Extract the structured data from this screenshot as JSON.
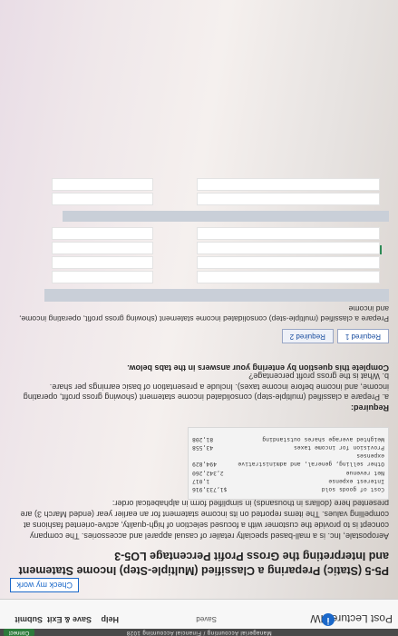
{
  "header": {
    "brand_strip_text": "Managerial Accounting / Financial Accounting 1028",
    "connect_label": "Connect",
    "course_title": "Post Lecture HW",
    "info_icon": "i",
    "saved_label": "Saved",
    "help_label": "Help",
    "save_exit_label": "Save & Exit",
    "submit_label": "Submit",
    "check_work_label": "Check my work"
  },
  "question": {
    "title": "P5-5 (Static) Preparing a Classified (Multiple-Step) Income Statement and Interpreting the Gross Profit Percentage LO5-3",
    "intro": "Aeropostale, Inc. is a mall-based specialty retailer of casual apparel and accessories. The company concept is to provide the customer with a focused selection of high-quality, active-oriented fashions at compelling values. The items reported on its income statement for an earlier year (ended March 3) are presented here (dollars in thousands) in simplified form in alphabetical order:",
    "data_rows": [
      {
        "label": "Cost of goods sold",
        "value": "$1,733,916"
      },
      {
        "label": "Interest expense",
        "value": "1,017"
      },
      {
        "label": "Net revenue",
        "value": "2,342,260"
      },
      {
        "label": "Other selling, general, and administrative expenses",
        "value": "494,829"
      },
      {
        "label": "Provision for income taxes",
        "value": "43,558"
      },
      {
        "label": "Weighted average shares outstanding",
        "value": "81,208"
      }
    ],
    "required_label": "Required:",
    "required_a": "a. Prepare a classified (multiple-step) consolidated income statement (showing gross profit, operating income, and income before income taxes). Include a presentation of basic earnings per share.",
    "required_b": "b. What is the gross profit percentage?",
    "complete_note": "Complete this question by entering your answers in the tabs below.",
    "tabs": [
      {
        "label": "Required 1"
      },
      {
        "label": "Required 2"
      }
    ],
    "tab_description": "Prepare a classified (multiple-step) consolidated income statement (showing gross profit, operating income, and income"
  },
  "colors": {
    "accent": "#1b68c9",
    "connect_green": "#2c7a3a"
  }
}
